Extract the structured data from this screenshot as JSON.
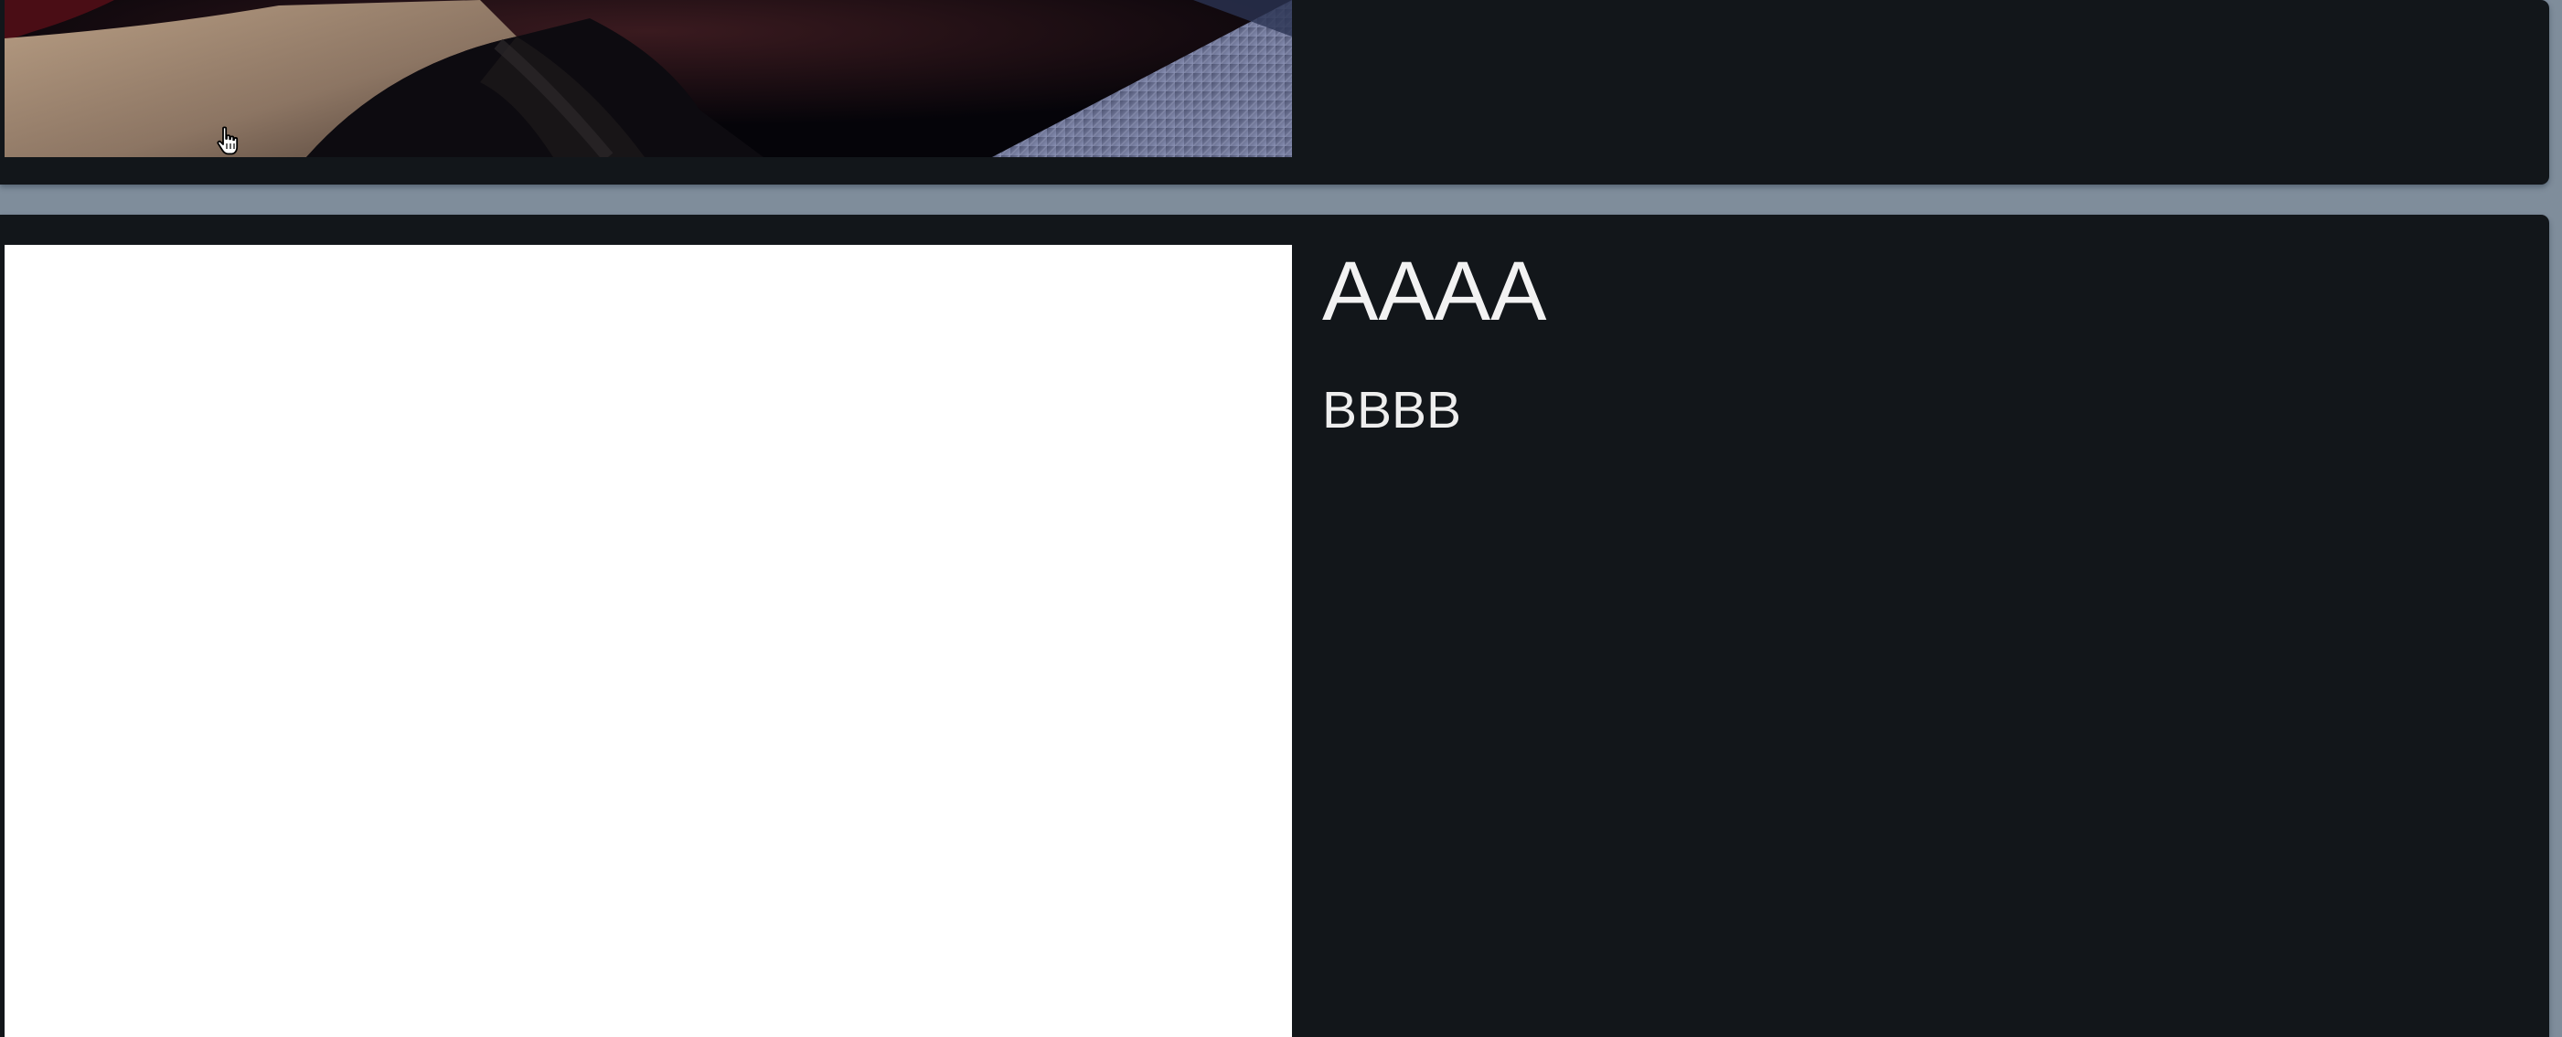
{
  "cards": [
    {
      "title": "",
      "subtitle": "",
      "image": "portrait-photo"
    },
    {
      "title": "AAAA",
      "subtitle": "BBBB",
      "image": "blank-white"
    }
  ],
  "cursor": "hand-pointer-icon",
  "colors": {
    "page_background": "#7f8d9b",
    "card_background": "#12161a",
    "text": "#f2f2f2",
    "image_placeholder": "#ffffff"
  }
}
